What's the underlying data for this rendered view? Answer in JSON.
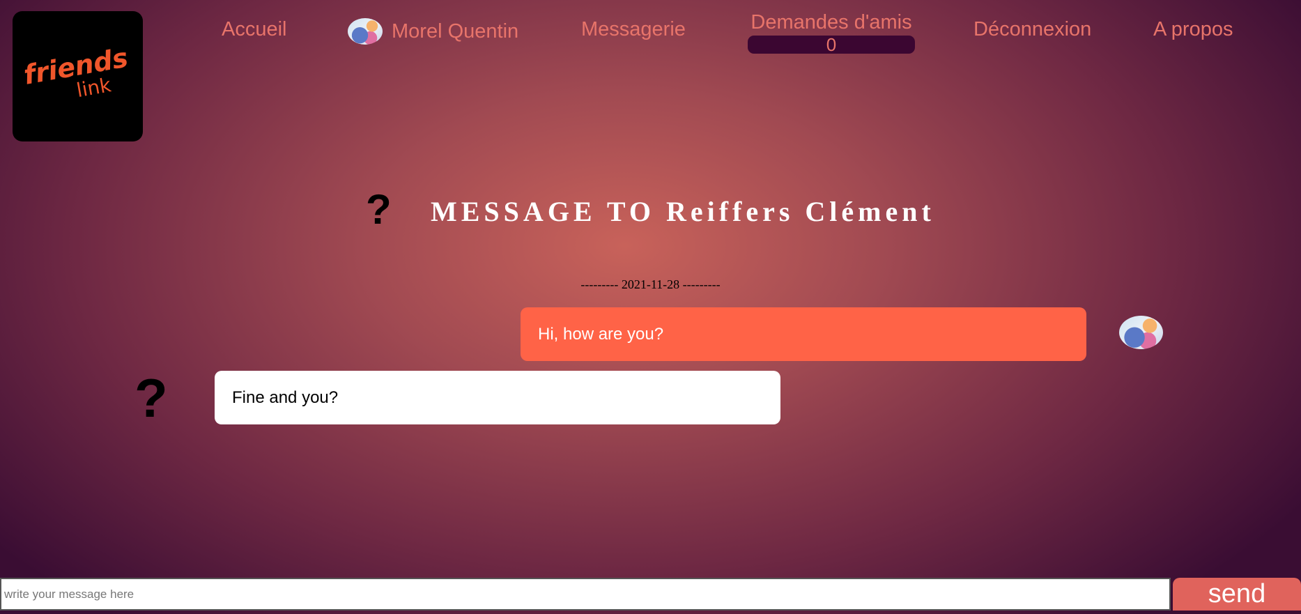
{
  "logo": {
    "line1": "friends",
    "line2": "link"
  },
  "nav": {
    "home": "Accueil",
    "profile_name": "Morel Quentin",
    "messages": "Messagerie",
    "friend_requests": {
      "label": "Demandes d'amis",
      "count": "0"
    },
    "logout": "Déconnexion",
    "about": "A propos"
  },
  "conversation": {
    "title": "MESSAGE TO Reiffers Clément",
    "unknown_avatar_glyph": "?",
    "date_separator": "--------- 2021-11-28 ---------",
    "messages": [
      {
        "direction": "sent",
        "text": "Hi, how are you?"
      },
      {
        "direction": "received",
        "text": "Fine and you?"
      }
    ]
  },
  "composer": {
    "placeholder": "write your message here",
    "value": "",
    "send_label": "send"
  },
  "colors": {
    "accent": "#e8746a",
    "sent_bubble": "#ff6347",
    "received_bubble": "#ffffff",
    "send_button": "#e0635c",
    "badge_bg": "#3b0631"
  }
}
